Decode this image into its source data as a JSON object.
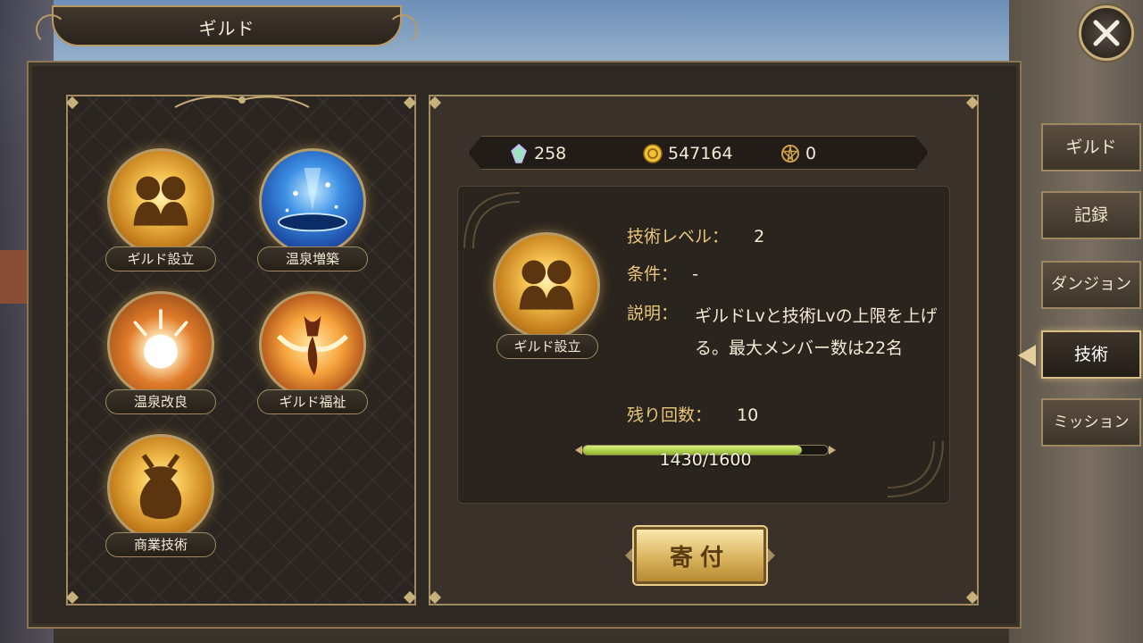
{
  "header": {
    "title": "ギルド"
  },
  "currencies": [
    {
      "icon": "crystal-icon",
      "value": "258"
    },
    {
      "icon": "gold-coin-icon",
      "value": "547164"
    },
    {
      "icon": "guild-point-icon",
      "value": "0"
    }
  ],
  "skills": [
    {
      "label": "ギルド設立",
      "icon": "guild-founding-icon"
    },
    {
      "label": "温泉増築",
      "icon": "hot-spring-expansion-icon"
    },
    {
      "label": "温泉改良",
      "icon": "hot-spring-improvement-icon"
    },
    {
      "label": "ギルド福祉",
      "icon": "guild-welfare-icon"
    },
    {
      "label": "商業技術",
      "icon": "commerce-tech-icon"
    }
  ],
  "detail": {
    "icon_label": "ギルド設立",
    "level_key": "技術レベル：",
    "level_value": "2",
    "condition_key": "条件：",
    "condition_value": "-",
    "description_key": "説明：",
    "description_value": "ギルドLvと技術Lvの上限を上げる。最大メンバー数は22名",
    "remaining_key": "残り回数：",
    "remaining_value": "10",
    "progress_text": "1430/1600",
    "progress_fraction": 0.89375
  },
  "donate_button": {
    "label": "寄付"
  },
  "tabs": [
    {
      "label": "ギルド",
      "active": false
    },
    {
      "label": "記録",
      "active": false
    },
    {
      "label": "ダンジョン",
      "active": false
    },
    {
      "label": "技術",
      "active": true
    },
    {
      "label": "ミッション",
      "active": false
    }
  ],
  "colors": {
    "gold_accent": "#c8b07a",
    "progress_green": "#a7cf3b",
    "panel_dark": "#2a241e"
  }
}
